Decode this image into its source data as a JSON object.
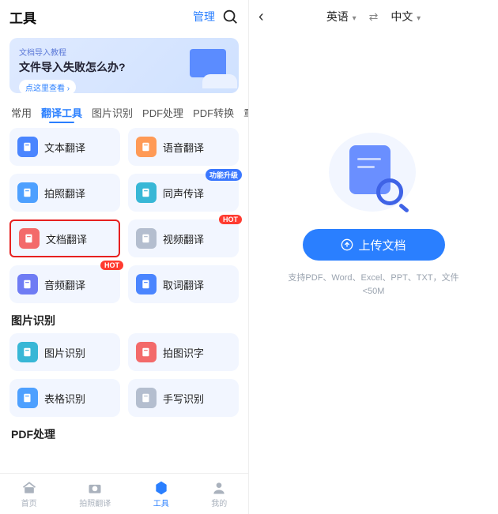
{
  "left": {
    "header": {
      "title": "工具",
      "manage": "管理"
    },
    "banner": {
      "subtitle": "文档导入教程",
      "title": "文件导入失败怎么办?",
      "button": "点这里查看 ›"
    },
    "tabs": [
      "常用",
      "翻译工具",
      "图片识别",
      "PDF处理",
      "PDF转换"
    ],
    "tabs_active_index": 1,
    "tabs_overflow": "章",
    "sections": [
      {
        "title": "",
        "tools": [
          {
            "label": "文本翻译",
            "icon_color": "blue",
            "badge": null,
            "highlight": false
          },
          {
            "label": "语音翻译",
            "icon_color": "orange",
            "badge": null,
            "highlight": false
          },
          {
            "label": "拍照翻译",
            "icon_color": "blue2",
            "badge": null,
            "highlight": false
          },
          {
            "label": "同声传译",
            "icon_color": "teal",
            "badge": "功能升级",
            "highlight": false
          },
          {
            "label": "文档翻译",
            "icon_color": "red",
            "badge": null,
            "highlight": true
          },
          {
            "label": "视频翻译",
            "icon_color": "grey",
            "badge": "HOT",
            "highlight": false
          },
          {
            "label": "音频翻译",
            "icon_color": "purple",
            "badge": "HOT",
            "highlight": false
          },
          {
            "label": "取词翻译",
            "icon_color": "blue",
            "badge": null,
            "highlight": false
          }
        ]
      },
      {
        "title": "图片识别",
        "tools": [
          {
            "label": "图片识别",
            "icon_color": "teal",
            "badge": null,
            "highlight": false
          },
          {
            "label": "拍图识字",
            "icon_color": "red",
            "badge": null,
            "highlight": false
          },
          {
            "label": "表格识别",
            "icon_color": "blue2",
            "badge": null,
            "highlight": false
          },
          {
            "label": "手写识别",
            "icon_color": "grey",
            "badge": null,
            "highlight": false
          }
        ]
      },
      {
        "title": "PDF处理",
        "tools": []
      }
    ],
    "tabbar": [
      {
        "label": "首页",
        "icon": "home"
      },
      {
        "label": "拍照翻译",
        "icon": "camera"
      },
      {
        "label": "工具",
        "icon": "hex",
        "active": true
      },
      {
        "label": "我的",
        "icon": "user"
      }
    ]
  },
  "right": {
    "back_icon": "chevron-left",
    "lang_from": "英语",
    "lang_to": "中文",
    "upload_label": "上传文档",
    "hint": "支持PDF、Word、Excel、PPT、TXT，文件<50M"
  }
}
